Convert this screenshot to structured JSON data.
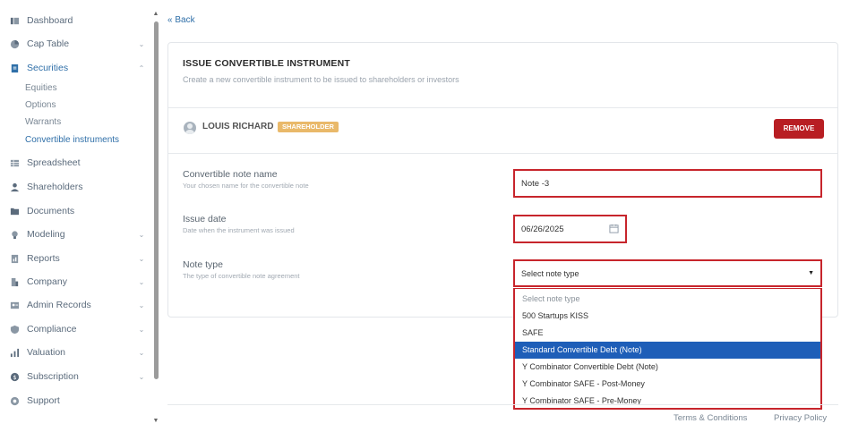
{
  "sidebar": {
    "items": [
      {
        "label": "Dashboard",
        "icon": "dashboard-icon",
        "chevron": ""
      },
      {
        "label": "Cap Table",
        "icon": "pie-chart-icon",
        "chevron": "⌄"
      },
      {
        "label": "Securities",
        "icon": "document-icon",
        "chevron": "⌃"
      },
      {
        "label": "Spreadsheet",
        "icon": "grid-icon",
        "chevron": ""
      },
      {
        "label": "Shareholders",
        "icon": "user-icon",
        "chevron": ""
      },
      {
        "label": "Documents",
        "icon": "folder-icon",
        "chevron": ""
      },
      {
        "label": "Modeling",
        "icon": "bulb-icon",
        "chevron": "⌄"
      },
      {
        "label": "Reports",
        "icon": "report-icon",
        "chevron": "⌄"
      },
      {
        "label": "Company",
        "icon": "building-icon",
        "chevron": "⌄"
      },
      {
        "label": "Admin Records",
        "icon": "admin-icon",
        "chevron": "⌄"
      },
      {
        "label": "Compliance",
        "icon": "shield-icon",
        "chevron": "⌄"
      },
      {
        "label": "Valuation",
        "icon": "chart-icon",
        "chevron": "⌄"
      },
      {
        "label": "Subscription",
        "icon": "dollar-icon",
        "chevron": "⌄"
      },
      {
        "label": "Support",
        "icon": "support-icon",
        "chevron": ""
      }
    ],
    "sub_items": [
      "Equities",
      "Options",
      "Warrants",
      "Convertible instruments"
    ]
  },
  "back_label": "Back",
  "card": {
    "title": "ISSUE CONVERTIBLE INSTRUMENT",
    "subtitle": "Create a new convertible instrument to be issued to shareholders or investors",
    "holder_name": "LOUIS RICHARD",
    "holder_badge": "SHAREHOLDER",
    "remove_label": "REMOVE",
    "fields": {
      "note_name_label": "Convertible note name",
      "note_name_help": "Your chosen name for the convertible note",
      "note_name_value": "Note -3",
      "issue_date_label": "Issue date",
      "issue_date_help": "Date when the instrument was issued",
      "issue_date_value": "06/26/2025",
      "note_type_label": "Note type",
      "note_type_help": "The type of convertible note agreement",
      "note_type_value": "Select note type"
    },
    "note_type_options": [
      "Select note type",
      "500 Startups KISS",
      "SAFE",
      "Standard Convertible Debt (Note)",
      "Y Combinator Convertible Debt (Note)",
      "Y Combinator SAFE - Post-Money",
      "Y Combinator SAFE - Pre-Money"
    ],
    "highlighted_option_index": 3
  },
  "footer": {
    "terms": "Terms & Conditions",
    "privacy": "Privacy Policy"
  },
  "colors": {
    "accent": "#2f6fa8",
    "danger": "#b81e23",
    "badge": "#e9b96a",
    "highlight": "#1e5eb8"
  }
}
